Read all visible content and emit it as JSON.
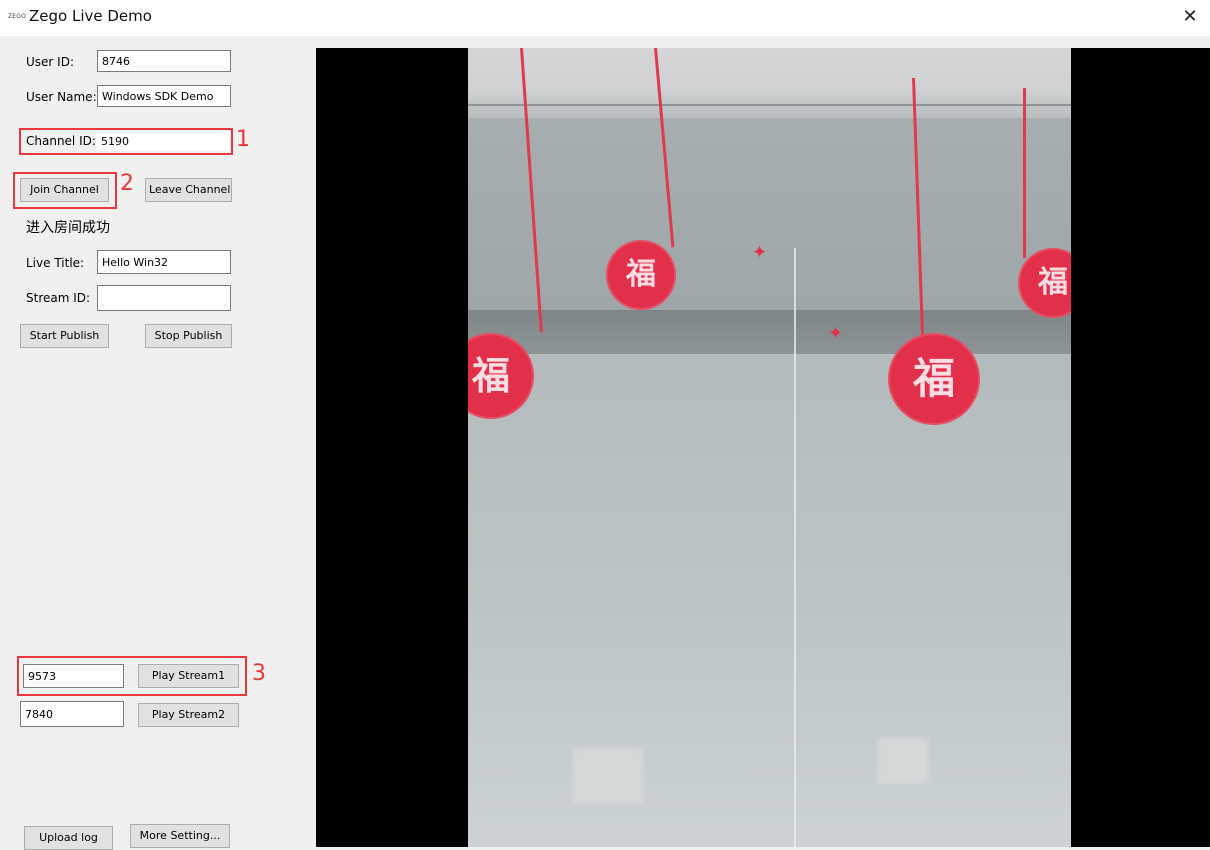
{
  "window": {
    "logo_text": "ZEGO",
    "title": "Zego Live Demo",
    "close_glyph": "✕"
  },
  "form": {
    "user_id_label": "User ID:",
    "user_id_value": "8746",
    "user_name_label": "User Name:",
    "user_name_value": "Windows SDK Demo",
    "channel_id_label": "Channel ID:",
    "channel_id_value": "5190",
    "join_channel_label": "Join Channel",
    "leave_channel_label": "Leave Channel",
    "status_text": "进入房间成功",
    "live_title_label": "Live Title:",
    "live_title_value": "Hello Win32",
    "stream_id_label": "Stream ID:",
    "stream_id_value": "",
    "start_publish_label": "Start Publish",
    "stop_publish_label": "Stop Publish",
    "stream1_value": "9573",
    "play_stream1_label": "Play Stream1",
    "stream2_value": "7840",
    "play_stream2_label": "Play Stream2",
    "upload_log_label": "Upload log",
    "more_setting_label": "More Setting..."
  },
  "annotations": {
    "marker_1": "1",
    "marker_2": "2",
    "marker_3": "3",
    "color": "#e8383d"
  },
  "video": {
    "ornament_glyph": "福",
    "sparkle_glyph": "✦",
    "background_color": "#000000",
    "ornament_color": "#e2304a"
  }
}
